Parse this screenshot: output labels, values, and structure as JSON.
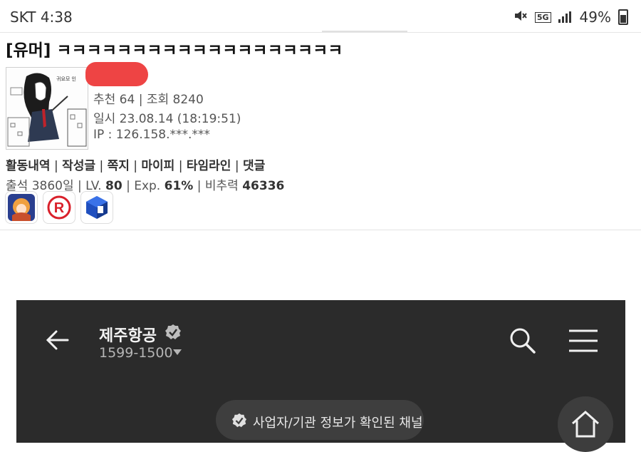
{
  "status": {
    "carrier_time": "SKT 4:38",
    "net": "5G",
    "battery": "49%"
  },
  "post": {
    "title": "[유머] ㅋㅋㅋㅋㅋㅋㅋㅋㅋㅋㅋㅋㅋㅋㅋㅋㅋㅋㅋ",
    "avatar_caption": "귀요모 인",
    "recommend_views": "추천 64 | 조회 8240",
    "datetime": "일시 23.08.14 (18:19:51)",
    "ip": "IP : 126.158.***.***"
  },
  "links": {
    "activity": "활동내역",
    "posts": "작성글",
    "message": "쪽지",
    "mypi": "마이피",
    "timeline": "타임라인",
    "comments": "댓글"
  },
  "stats": {
    "attendance_label": "출석",
    "attendance": "3860일",
    "lv_label": "LV.",
    "lv": "80",
    "exp_label": "Exp.",
    "exp": "61%",
    "ratio_label": "비추력",
    "ratio": "46336"
  },
  "embed": {
    "channel_name": "제주항공",
    "phone": "1599-1500",
    "verified_text": "사업자/기관 정보가 확인된 채널"
  },
  "colors": {
    "embed_bg": "#2b2b2b",
    "redaction": "#ee4444"
  },
  "icons": [
    "mute-icon",
    "signal-icon",
    "battery-icon",
    "back-arrow-icon",
    "verified-check-icon",
    "search-icon",
    "menu-icon",
    "home-icon"
  ]
}
